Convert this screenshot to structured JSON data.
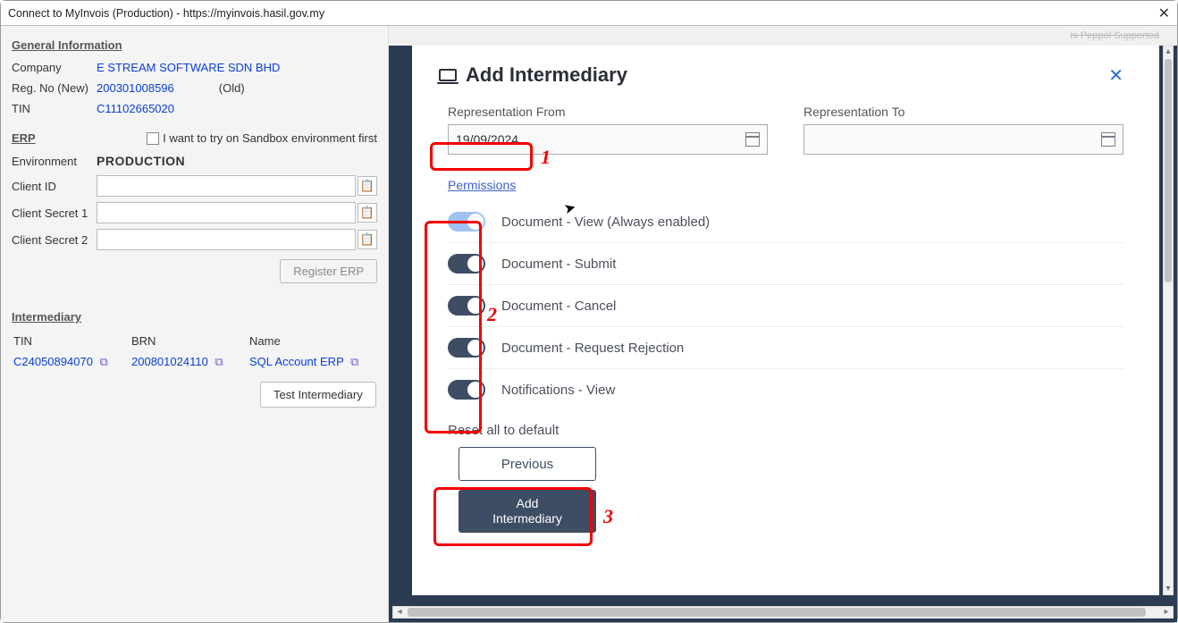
{
  "window": {
    "title": "Connect to MyInvois (Production) - https://myinvois.hasil.gov.my"
  },
  "general": {
    "heading": "General Information",
    "company_label": "Company",
    "company_value": "E STREAM SOFTWARE SDN BHD",
    "regno_label": "Reg. No (New)",
    "regno_value": "200301008596",
    "regno_old_label": "(Old)",
    "tin_label": "TIN",
    "tin_value": "C11102665020"
  },
  "erp": {
    "heading": "ERP",
    "sandbox_label": "I want to try on Sandbox environment first",
    "env_label": "Environment",
    "env_value": "PRODUCTION",
    "clientid_label": "Client ID",
    "clientid_value": "",
    "secret1_label": "Client Secret 1",
    "secret1_value": "",
    "secret2_label": "Client Secret 2",
    "secret2_value": "",
    "register_btn": "Register ERP"
  },
  "intermediary_left": {
    "heading": "Intermediary",
    "col_tin": "TIN",
    "col_brn": "BRN",
    "col_name": "Name",
    "row_tin": "C24050894070",
    "row_brn": "200801024110",
    "row_name": "SQL Account ERP",
    "test_btn": "Test Intermediary"
  },
  "webview": {
    "top_hint": "Is Peppol Supported",
    "title": "Add Intermediary",
    "rep_from_label": "Representation From",
    "rep_from_value": "19/09/2024",
    "rep_to_label": "Representation To",
    "rep_to_value": "",
    "permissions_heading": "Permissions",
    "perms": [
      "Document - View (Always enabled)",
      "Document - Submit",
      "Document - Cancel",
      "Document - Request Rejection",
      "Notifications - View"
    ],
    "reset_label": "Reset all to default",
    "prev_btn": "Previous",
    "add_btn": "Add\nIntermediary"
  },
  "annotations": {
    "n1": "1",
    "n2": "2",
    "n3": "3"
  }
}
